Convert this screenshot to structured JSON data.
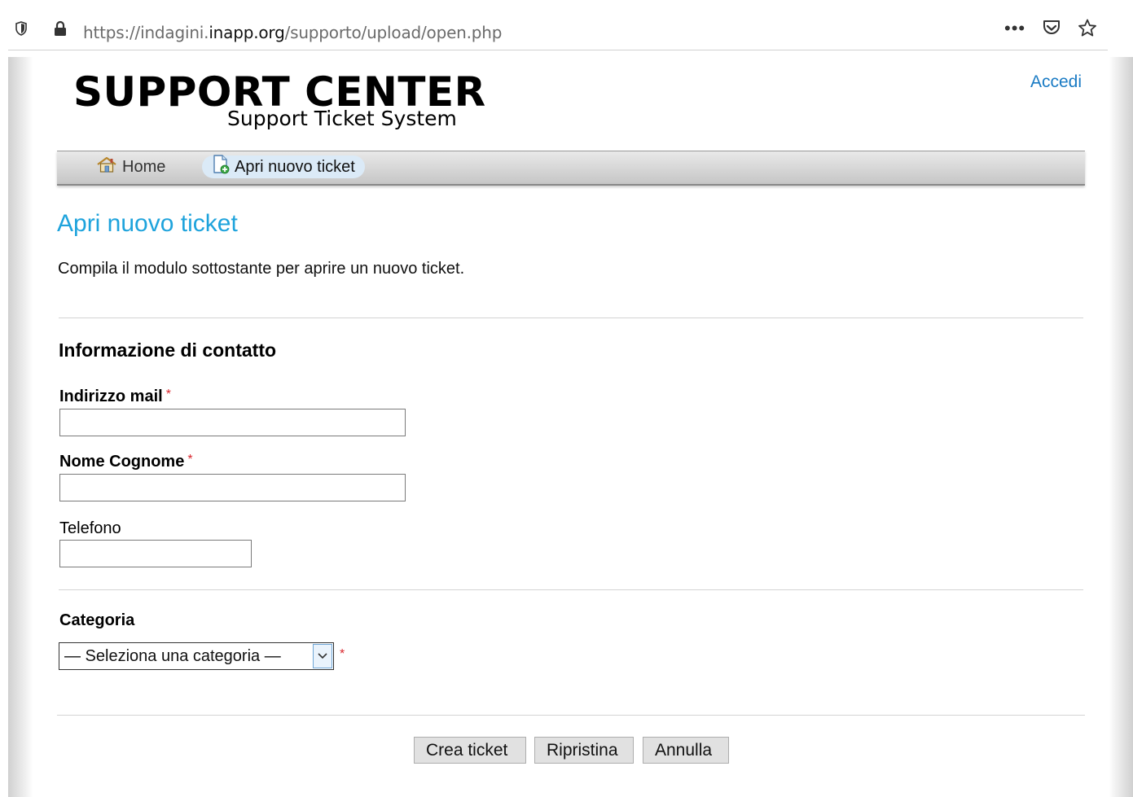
{
  "browser": {
    "url_prefix": "https://indagini.",
    "url_domain": "inapp.org",
    "url_path": "/supporto/upload/open.php",
    "more_label": "•••"
  },
  "header": {
    "title": "SUPPORT CENTER",
    "subtitle": "Support Ticket System",
    "login_label": "Accedi"
  },
  "nav": {
    "items": [
      {
        "label": "Home"
      },
      {
        "label": "Apri nuovo ticket"
      }
    ]
  },
  "main": {
    "title": "Apri nuovo ticket",
    "intro": "Compila il modulo sottostante per aprire un nuovo ticket.",
    "contact_section": "Informazione di contatto",
    "email_label": "Indirizzo mail",
    "name_label": "Nome Cognome",
    "phone_label": "Telefono",
    "required_mark": "*",
    "email_value": "",
    "name_value": "",
    "phone_value": "",
    "category_label": "Categoria",
    "category_selected": "— Seleziona una categoria —"
  },
  "buttons": {
    "create": "Crea ticket",
    "reset": "Ripristina",
    "cancel": "Annulla"
  },
  "colors": {
    "link": "#1a7bc4",
    "title": "#1ea3dc",
    "required": "#d9272e",
    "active_tab": "#dbeaf7"
  },
  "icons": {
    "home": "home-icon",
    "new_ticket": "new-ticket-icon"
  }
}
